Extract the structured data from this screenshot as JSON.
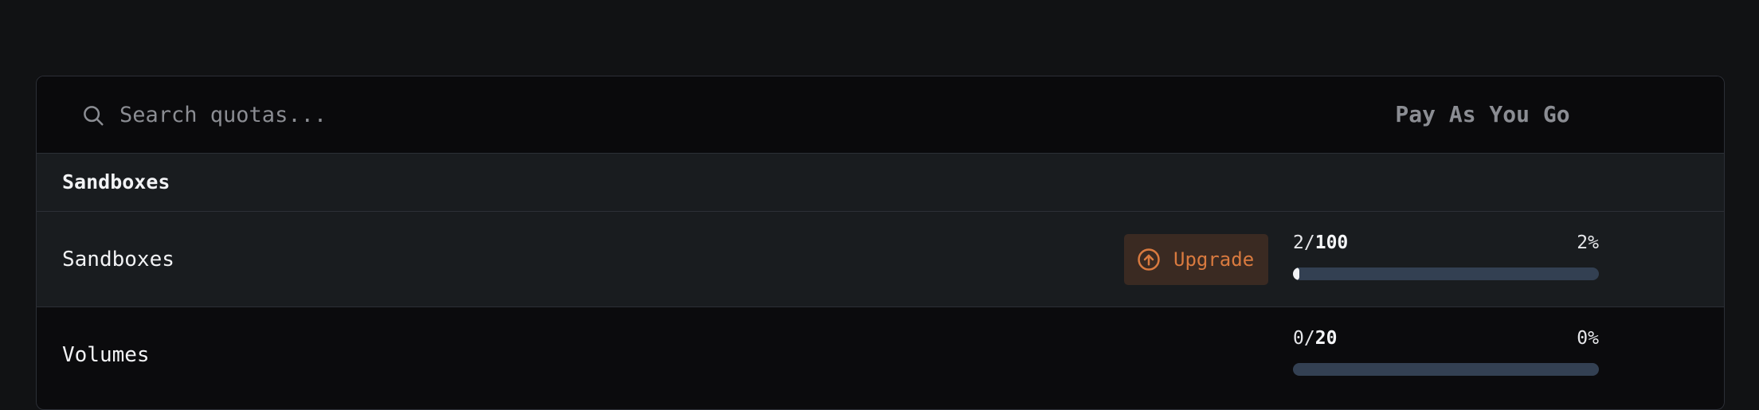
{
  "search": {
    "placeholder": "Search quotas...",
    "value": ""
  },
  "plan": {
    "title": "Pay As You Go"
  },
  "groups": [
    {
      "label": "Sandboxes",
      "quotas": [
        {
          "name": "Sandboxes",
          "used": "2",
          "separator": "/",
          "limit": "100",
          "percent_label": "2%",
          "fraction": 0.02,
          "upgrade_label": "Upgrade"
        },
        {
          "name": "Volumes",
          "used": "0",
          "separator": "/",
          "limit": "20",
          "percent_label": "0%",
          "fraction": 0.0
        }
      ]
    }
  ],
  "colors": {
    "accent": "#d97a3f",
    "progress_track": "#334052",
    "progress_fill": "#f2f3f5"
  },
  "icons": {
    "search": "search-icon",
    "upgrade": "arrow-up-circle-icon"
  }
}
